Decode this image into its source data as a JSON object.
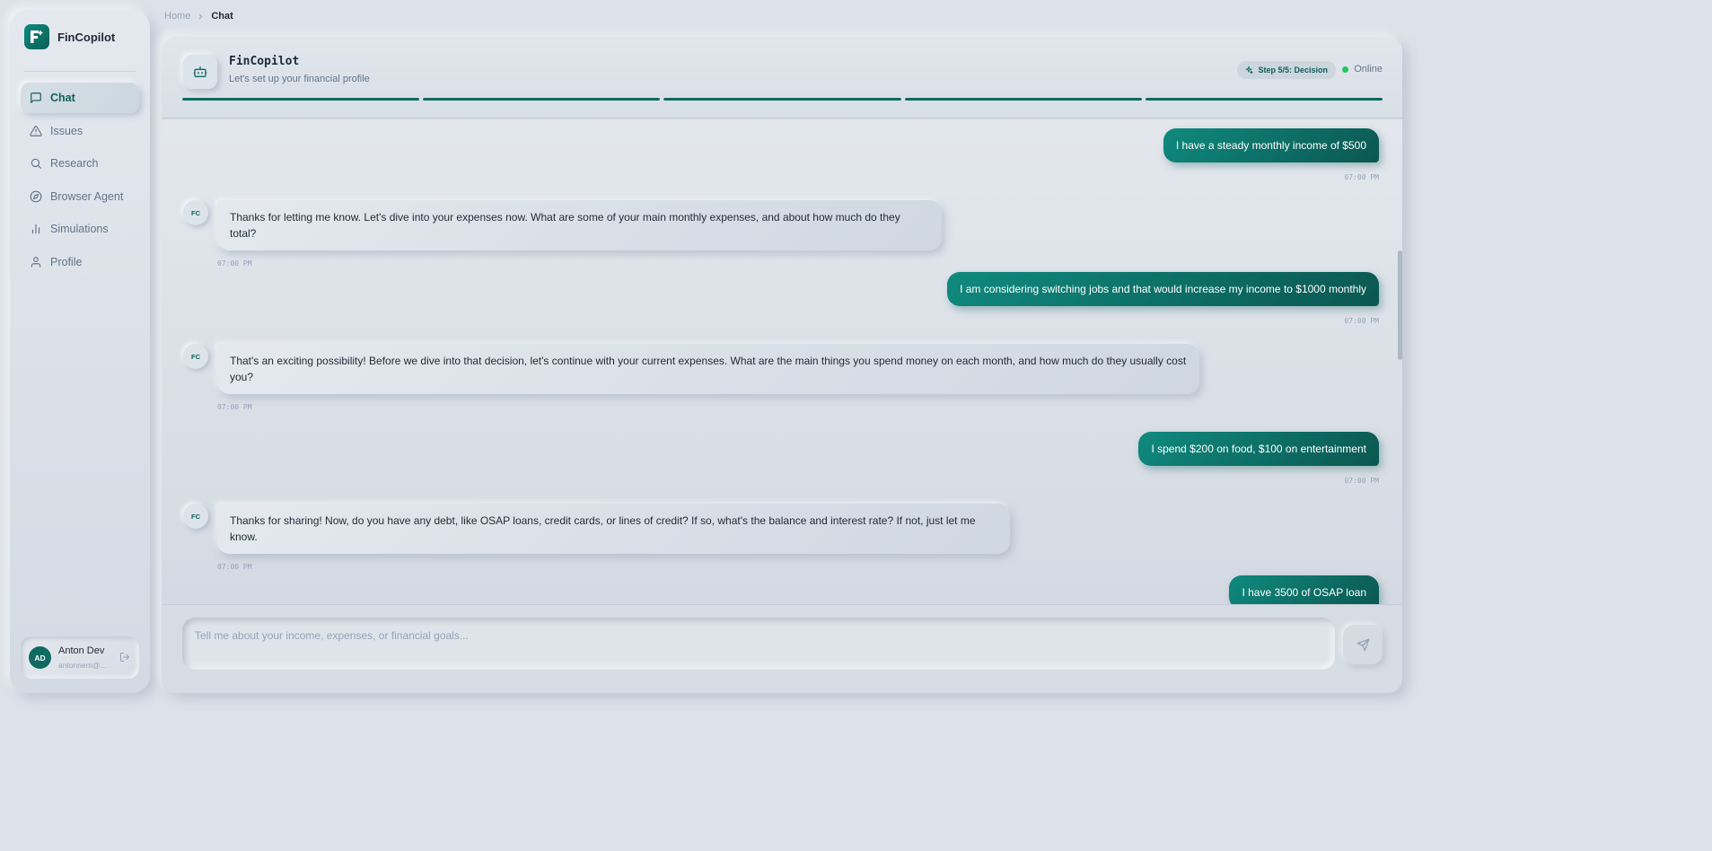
{
  "app": {
    "name": "FinCopilot"
  },
  "sidebar": {
    "items": [
      {
        "label": "Chat",
        "icon": "message-square-icon",
        "active": true
      },
      {
        "label": "Issues",
        "icon": "alert-triangle-icon",
        "active": false
      },
      {
        "label": "Research",
        "icon": "search-icon",
        "active": false
      },
      {
        "label": "Browser Agent",
        "icon": "compass-icon",
        "active": false
      },
      {
        "label": "Simulations",
        "icon": "bar-chart-icon",
        "active": false
      },
      {
        "label": "Profile",
        "icon": "user-icon",
        "active": false
      }
    ],
    "user": {
      "initials": "AD",
      "name": "Anton Dev",
      "email": "antonnem@..."
    }
  },
  "breadcrumb": {
    "home": "Home",
    "current": "Chat"
  },
  "chat": {
    "title": "FinCopilot",
    "subtitle": "Let's set up your financial profile",
    "step_badge": "Step 5/5: Decision",
    "status": "Online",
    "progress": {
      "total_steps": 5,
      "completed_steps": 5
    },
    "messages": [
      {
        "role": "user",
        "text": "I have a steady monthly income of $500",
        "time": "07:00 PM"
      },
      {
        "role": "bot",
        "avatar": "FC",
        "text": "Thanks for letting me know. Let's dive into your expenses now. What are some of your main monthly expenses, and about how much do they total?",
        "time": "07:00 PM"
      },
      {
        "role": "user",
        "text": "I am considering switching jobs and that would increase my income to $1000 monthly",
        "time": "07:00 PM"
      },
      {
        "role": "bot",
        "avatar": "FC",
        "text": "That's an exciting possibility! Before we dive into that decision, let's continue with your current expenses. What are the main things you spend money on each month, and how much do they usually cost you?",
        "time": "07:00 PM"
      },
      {
        "role": "user",
        "text": "I spend $200 on food, $100 on entertainment",
        "time": "07:00 PM"
      },
      {
        "role": "bot",
        "avatar": "FC",
        "text": "Thanks for sharing! Now, do you have any debt, like OSAP loans, credit cards, or lines of credit? If so, what's the balance and interest rate? If not, just let me know.",
        "time": "07:00 PM"
      },
      {
        "role": "user",
        "text": "I have 3500 of OSAP loan",
        "time": ""
      }
    ],
    "input_placeholder": "Tell me about your income, expenses, or financial goals..."
  },
  "colors": {
    "accent": "#0f6a62",
    "online": "#22c55e"
  }
}
